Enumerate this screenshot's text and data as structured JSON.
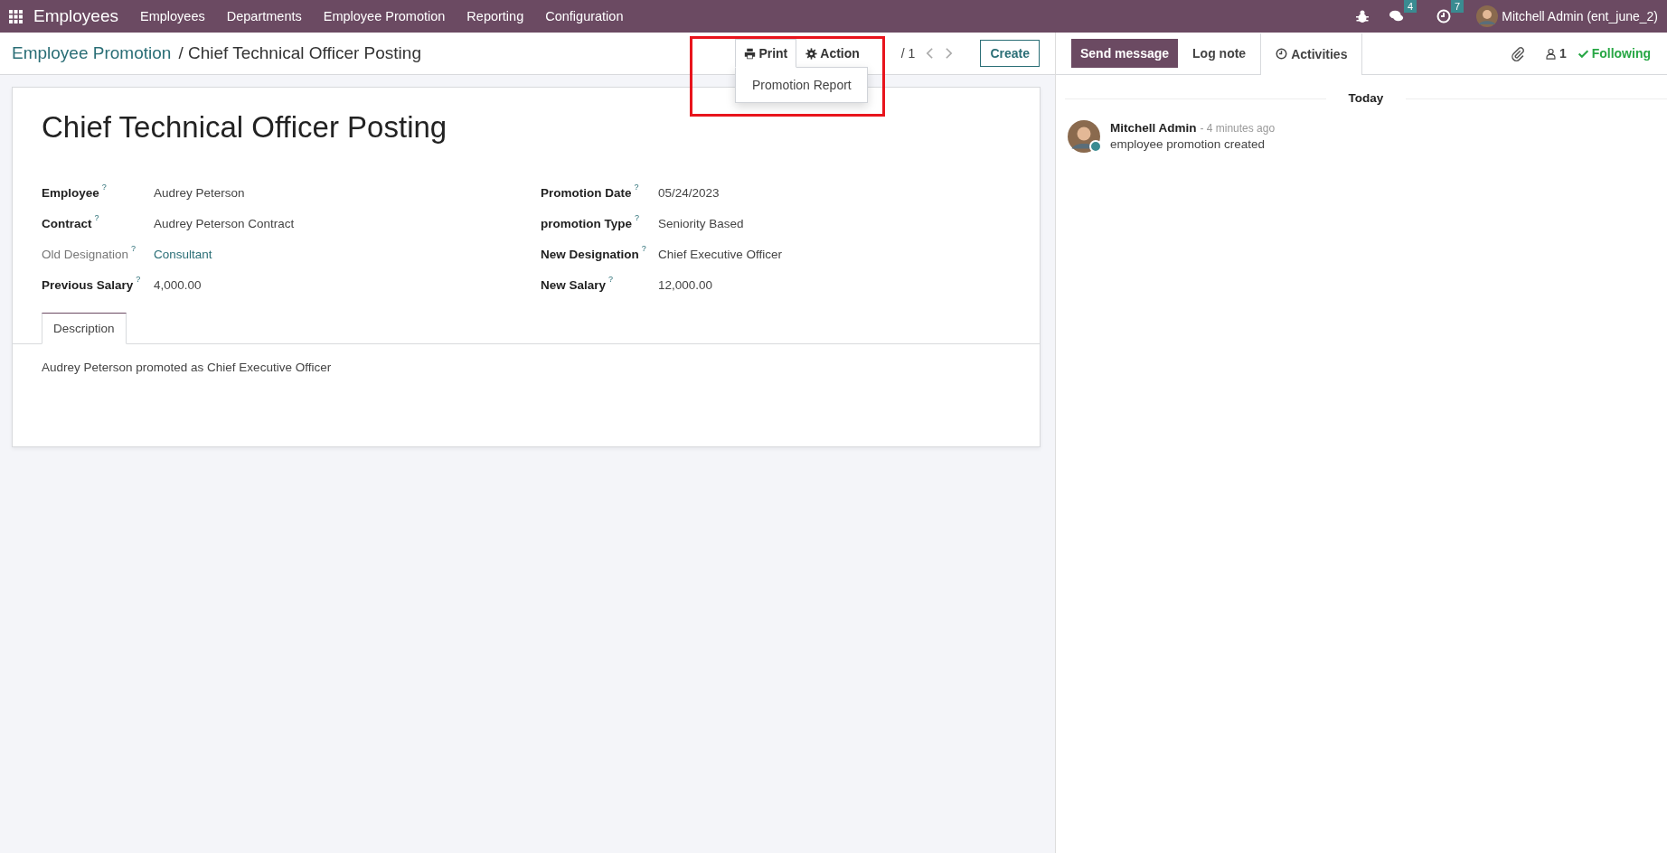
{
  "navbar": {
    "app": "Employees",
    "menus": [
      "Employees",
      "Departments",
      "Employee Promotion",
      "Reporting",
      "Configuration"
    ],
    "messages_count": "4",
    "activities_count": "7",
    "user": "Mitchell Admin (ent_june_2)"
  },
  "breadcrumb": {
    "parent": "Employee Promotion",
    "separator": "/",
    "current": "Chief Technical Officer Posting"
  },
  "toolbar": {
    "print": "Print",
    "action": "Action",
    "print_open": true,
    "dropdown_items": [
      "Promotion Report"
    ],
    "pager": "/ 1",
    "create": "Create"
  },
  "form": {
    "title": "Chief Technical Officer Posting",
    "left_fields": [
      {
        "label": "Employee",
        "hint": "?",
        "value": "Audrey Peterson",
        "muted": false,
        "link": false
      },
      {
        "label": "Contract",
        "hint": "?",
        "value": "Audrey Peterson Contract",
        "muted": false,
        "link": false
      },
      {
        "label": "Old Designation",
        "hint": "?",
        "value": "Consultant",
        "muted": true,
        "link": true
      },
      {
        "label": "Previous Salary",
        "hint": "?",
        "value": "4,000.00",
        "muted": false,
        "link": false
      }
    ],
    "right_fields": [
      {
        "label": "Promotion Date",
        "hint": "?",
        "value": "05/24/2023",
        "muted": false,
        "link": false
      },
      {
        "label": "promotion Type",
        "hint": "?",
        "value": "Seniority Based",
        "muted": false,
        "link": false
      },
      {
        "label": "New Designation",
        "hint": "?",
        "value": "Chief Executive Officer",
        "muted": false,
        "link": false
      },
      {
        "label": "New Salary",
        "hint": "?",
        "value": "12,000.00",
        "muted": false,
        "link": false
      }
    ],
    "tabs": [
      {
        "label": "Description",
        "selected": true
      }
    ],
    "description": "Audrey Peterson promoted as  Chief Executive Officer"
  },
  "chatter": {
    "send": "Send message",
    "log": "Log note",
    "activities": "Activities",
    "followers": "1",
    "following": "Following",
    "date": "Today",
    "messages": [
      {
        "author": "Mitchell Admin",
        "time": "- 4 minutes ago",
        "body": "employee promotion created"
      }
    ]
  }
}
